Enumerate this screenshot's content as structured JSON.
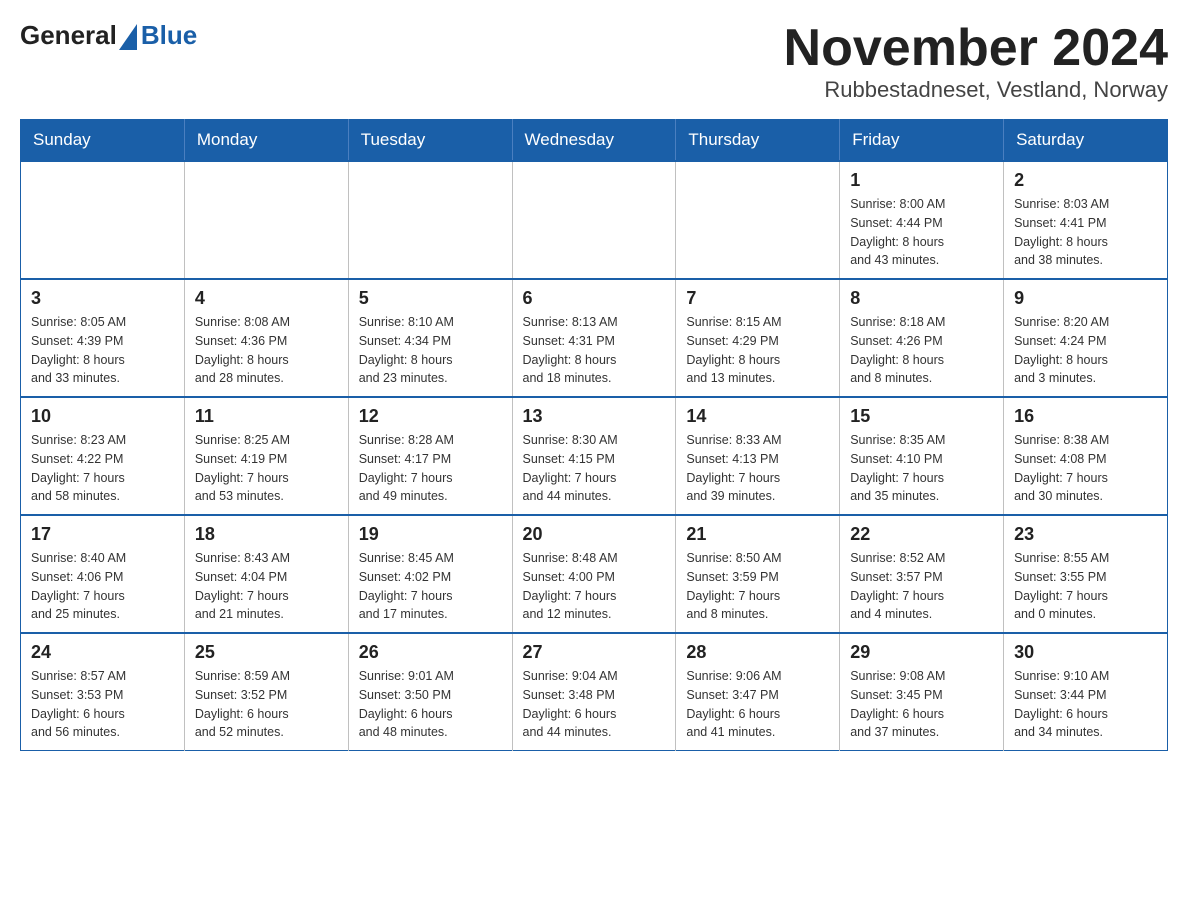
{
  "header": {
    "logo_general": "General",
    "logo_blue": "Blue",
    "title": "November 2024",
    "subtitle": "Rubbestadneset, Vestland, Norway"
  },
  "weekdays": [
    "Sunday",
    "Monday",
    "Tuesday",
    "Wednesday",
    "Thursday",
    "Friday",
    "Saturday"
  ],
  "weeks": [
    [
      {
        "day": "",
        "info": ""
      },
      {
        "day": "",
        "info": ""
      },
      {
        "day": "",
        "info": ""
      },
      {
        "day": "",
        "info": ""
      },
      {
        "day": "",
        "info": ""
      },
      {
        "day": "1",
        "info": "Sunrise: 8:00 AM\nSunset: 4:44 PM\nDaylight: 8 hours\nand 43 minutes."
      },
      {
        "day": "2",
        "info": "Sunrise: 8:03 AM\nSunset: 4:41 PM\nDaylight: 8 hours\nand 38 minutes."
      }
    ],
    [
      {
        "day": "3",
        "info": "Sunrise: 8:05 AM\nSunset: 4:39 PM\nDaylight: 8 hours\nand 33 minutes."
      },
      {
        "day": "4",
        "info": "Sunrise: 8:08 AM\nSunset: 4:36 PM\nDaylight: 8 hours\nand 28 minutes."
      },
      {
        "day": "5",
        "info": "Sunrise: 8:10 AM\nSunset: 4:34 PM\nDaylight: 8 hours\nand 23 minutes."
      },
      {
        "day": "6",
        "info": "Sunrise: 8:13 AM\nSunset: 4:31 PM\nDaylight: 8 hours\nand 18 minutes."
      },
      {
        "day": "7",
        "info": "Sunrise: 8:15 AM\nSunset: 4:29 PM\nDaylight: 8 hours\nand 13 minutes."
      },
      {
        "day": "8",
        "info": "Sunrise: 8:18 AM\nSunset: 4:26 PM\nDaylight: 8 hours\nand 8 minutes."
      },
      {
        "day": "9",
        "info": "Sunrise: 8:20 AM\nSunset: 4:24 PM\nDaylight: 8 hours\nand 3 minutes."
      }
    ],
    [
      {
        "day": "10",
        "info": "Sunrise: 8:23 AM\nSunset: 4:22 PM\nDaylight: 7 hours\nand 58 minutes."
      },
      {
        "day": "11",
        "info": "Sunrise: 8:25 AM\nSunset: 4:19 PM\nDaylight: 7 hours\nand 53 minutes."
      },
      {
        "day": "12",
        "info": "Sunrise: 8:28 AM\nSunset: 4:17 PM\nDaylight: 7 hours\nand 49 minutes."
      },
      {
        "day": "13",
        "info": "Sunrise: 8:30 AM\nSunset: 4:15 PM\nDaylight: 7 hours\nand 44 minutes."
      },
      {
        "day": "14",
        "info": "Sunrise: 8:33 AM\nSunset: 4:13 PM\nDaylight: 7 hours\nand 39 minutes."
      },
      {
        "day": "15",
        "info": "Sunrise: 8:35 AM\nSunset: 4:10 PM\nDaylight: 7 hours\nand 35 minutes."
      },
      {
        "day": "16",
        "info": "Sunrise: 8:38 AM\nSunset: 4:08 PM\nDaylight: 7 hours\nand 30 minutes."
      }
    ],
    [
      {
        "day": "17",
        "info": "Sunrise: 8:40 AM\nSunset: 4:06 PM\nDaylight: 7 hours\nand 25 minutes."
      },
      {
        "day": "18",
        "info": "Sunrise: 8:43 AM\nSunset: 4:04 PM\nDaylight: 7 hours\nand 21 minutes."
      },
      {
        "day": "19",
        "info": "Sunrise: 8:45 AM\nSunset: 4:02 PM\nDaylight: 7 hours\nand 17 minutes."
      },
      {
        "day": "20",
        "info": "Sunrise: 8:48 AM\nSunset: 4:00 PM\nDaylight: 7 hours\nand 12 minutes."
      },
      {
        "day": "21",
        "info": "Sunrise: 8:50 AM\nSunset: 3:59 PM\nDaylight: 7 hours\nand 8 minutes."
      },
      {
        "day": "22",
        "info": "Sunrise: 8:52 AM\nSunset: 3:57 PM\nDaylight: 7 hours\nand 4 minutes."
      },
      {
        "day": "23",
        "info": "Sunrise: 8:55 AM\nSunset: 3:55 PM\nDaylight: 7 hours\nand 0 minutes."
      }
    ],
    [
      {
        "day": "24",
        "info": "Sunrise: 8:57 AM\nSunset: 3:53 PM\nDaylight: 6 hours\nand 56 minutes."
      },
      {
        "day": "25",
        "info": "Sunrise: 8:59 AM\nSunset: 3:52 PM\nDaylight: 6 hours\nand 52 minutes."
      },
      {
        "day": "26",
        "info": "Sunrise: 9:01 AM\nSunset: 3:50 PM\nDaylight: 6 hours\nand 48 minutes."
      },
      {
        "day": "27",
        "info": "Sunrise: 9:04 AM\nSunset: 3:48 PM\nDaylight: 6 hours\nand 44 minutes."
      },
      {
        "day": "28",
        "info": "Sunrise: 9:06 AM\nSunset: 3:47 PM\nDaylight: 6 hours\nand 41 minutes."
      },
      {
        "day": "29",
        "info": "Sunrise: 9:08 AM\nSunset: 3:45 PM\nDaylight: 6 hours\nand 37 minutes."
      },
      {
        "day": "30",
        "info": "Sunrise: 9:10 AM\nSunset: 3:44 PM\nDaylight: 6 hours\nand 34 minutes."
      }
    ]
  ]
}
